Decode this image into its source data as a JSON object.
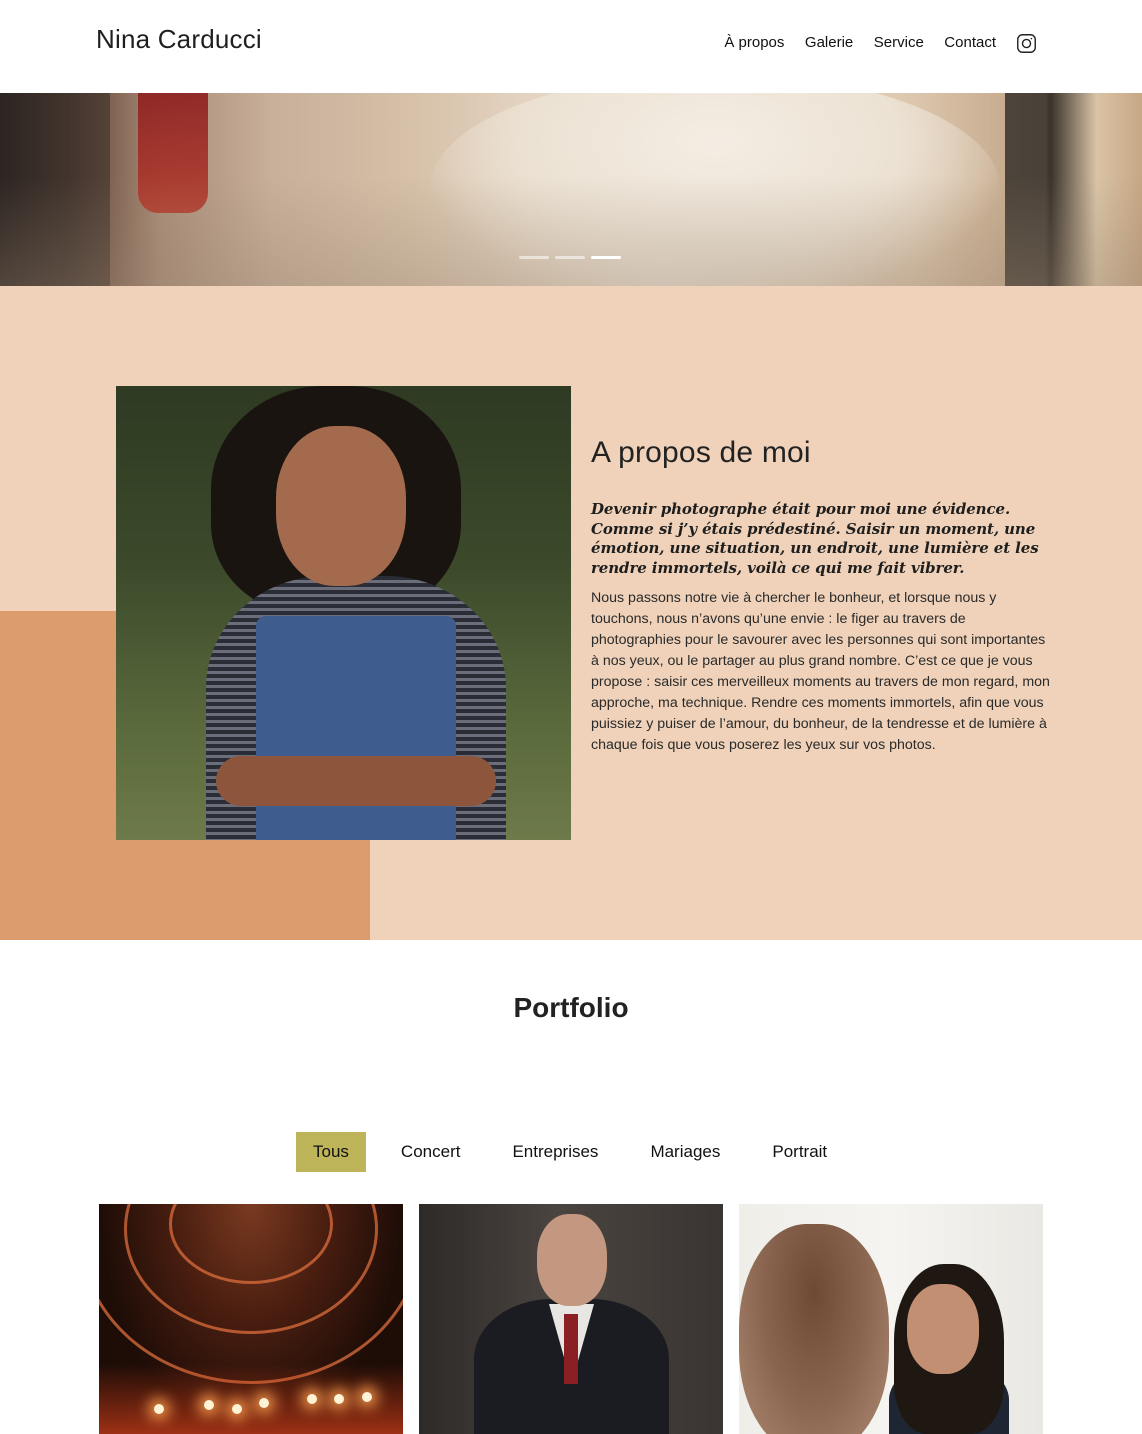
{
  "site": {
    "logo": "Nina Carducci"
  },
  "nav": {
    "items": [
      {
        "label": "À propos"
      },
      {
        "label": "Galerie"
      },
      {
        "label": "Service"
      },
      {
        "label": "Contact"
      }
    ],
    "social_icon": "instagram-icon"
  },
  "hero": {
    "slides_total": 3,
    "active_slide": 3
  },
  "about": {
    "title": "A propos de moi",
    "quote": "Devenir photographe était pour moi une évidence. Comme si j’y étais prédestiné. Saisir un moment, une émotion, une situation, un endroit, une lumière et les rendre immortels, voilà ce qui me fait vibrer.",
    "body": "Nous passons notre vie à chercher le bonheur, et lorsque nous y touchons, nous n’avons qu’une envie : le figer au travers de photographies pour le savourer avec les personnes qui sont importantes à nos yeux, ou le partager au plus grand nombre. C’est ce que je vous propose : saisir ces merveilleux moments au travers de mon regard, mon approche, ma technique. Rendre ces moments immortels, afin que vous puissiez y puiser de l’amour, du bonheur, de la tendresse et de lumière à chaque fois que vous poserez les yeux sur vos photos."
  },
  "portfolio": {
    "title": "Portfolio",
    "filters": [
      {
        "label": "Tous",
        "active": true
      },
      {
        "label": "Concert",
        "active": false
      },
      {
        "label": "Entreprises",
        "active": false
      },
      {
        "label": "Mariages",
        "active": false
      },
      {
        "label": "Portrait",
        "active": false
      }
    ]
  },
  "colors": {
    "about_bg": "#efd2b9",
    "about_accent": "#dd9c6d",
    "filter_active": "#beb45a"
  }
}
